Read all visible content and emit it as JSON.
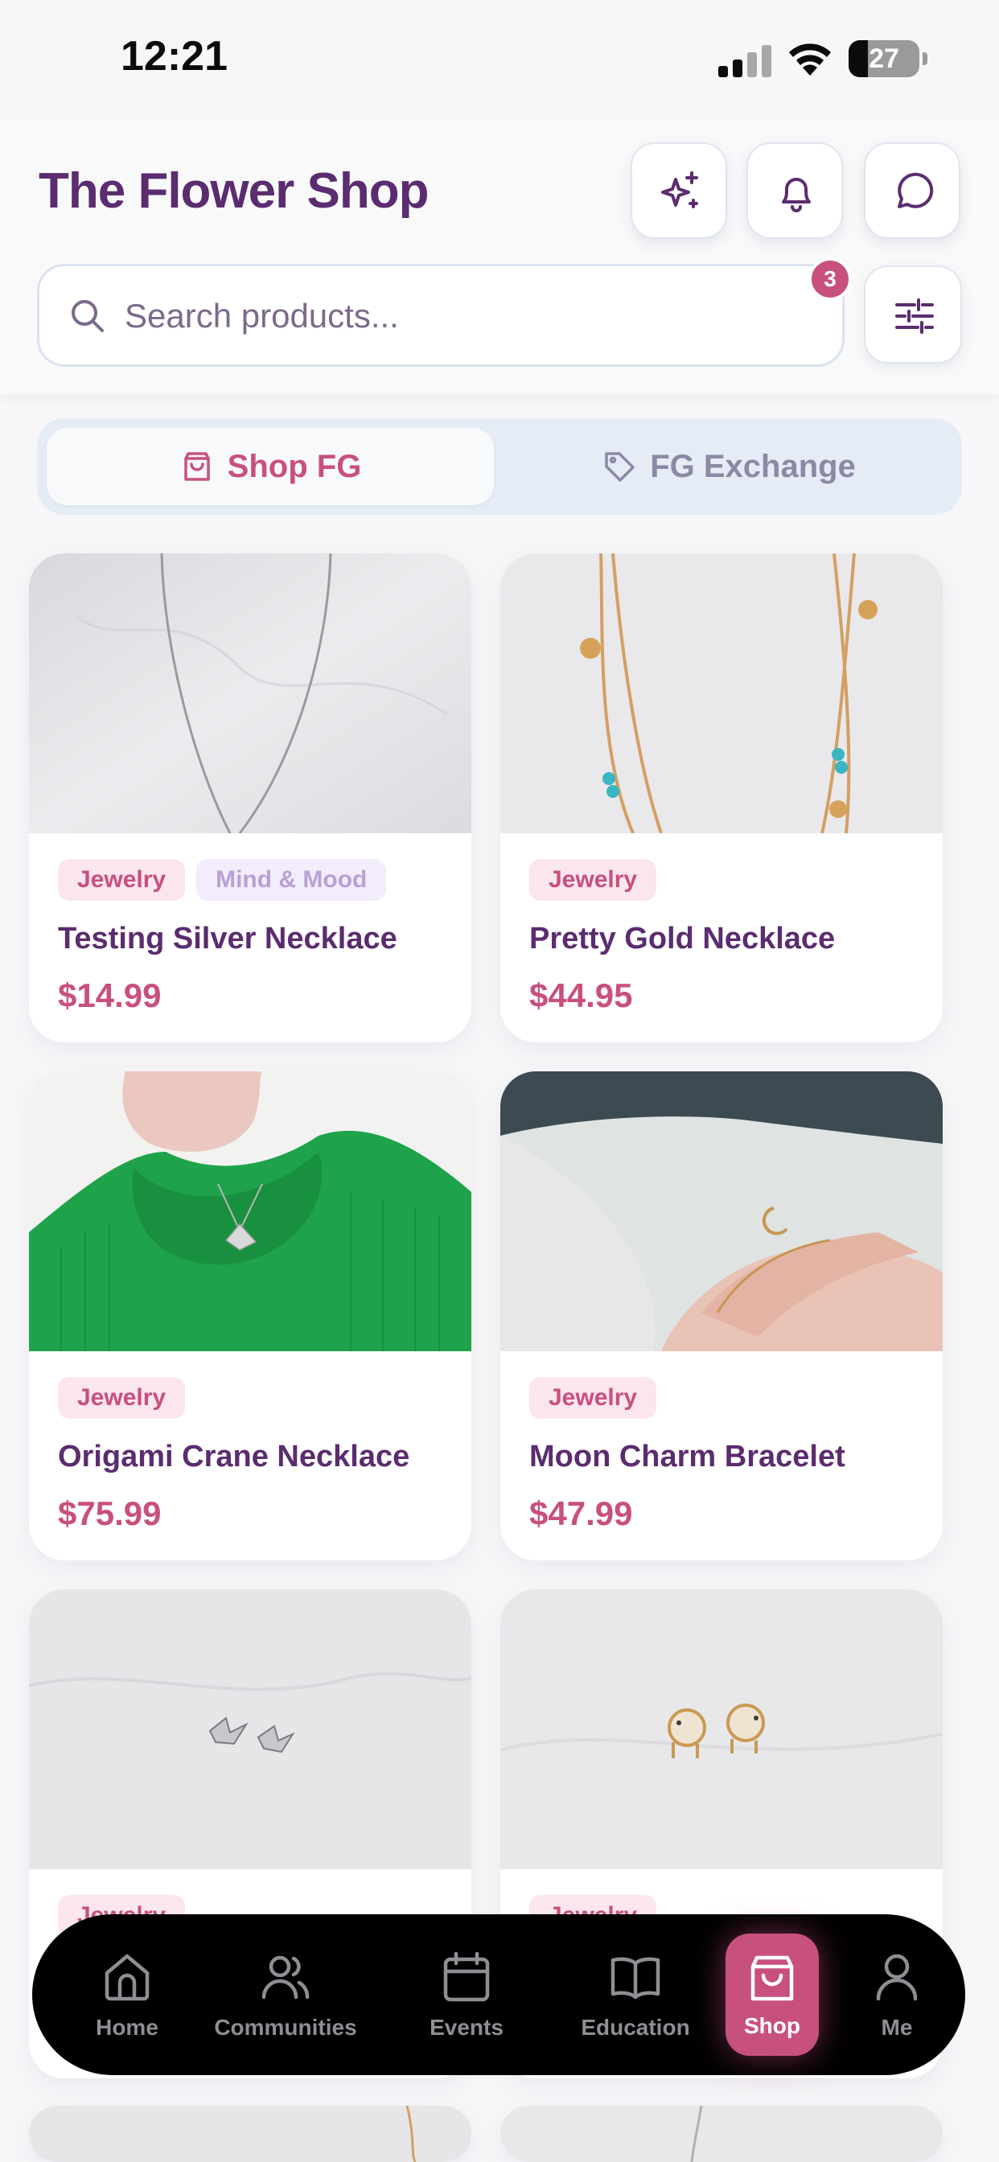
{
  "status_bar": {
    "time": "12:21",
    "battery_level": "27",
    "battery_fraction": 0.27
  },
  "header": {
    "title": "The Flower Shop",
    "notification_count": "3",
    "icons": [
      "sparkles-icon",
      "bell-icon",
      "chat-bubble-icon",
      "sliders-icon"
    ]
  },
  "search": {
    "placeholder": "Search products...",
    "value": ""
  },
  "tabs": [
    {
      "label": "Shop FG",
      "icon": "shopping-bag-icon",
      "active": true
    },
    {
      "label": "FG Exchange",
      "icon": "tag-icon",
      "active": false
    }
  ],
  "products": [
    {
      "tags": [
        "Jewelry",
        "Mind & Mood"
      ],
      "name": "Testing Silver Necklace",
      "price": "$14.99"
    },
    {
      "tags": [
        "Jewelry"
      ],
      "name": "Pretty Gold Necklace",
      "price": "$44.95"
    },
    {
      "tags": [
        "Jewelry"
      ],
      "name": "Origami Crane Necklace",
      "price": "$75.99"
    },
    {
      "tags": [
        "Jewelry"
      ],
      "name": "Moon Charm Bracelet",
      "price": "$47.99"
    },
    {
      "tags": [
        "Jewelry"
      ],
      "name": "",
      "price": ""
    },
    {
      "tags": [
        "Jewelry"
      ],
      "name": "",
      "price": ""
    }
  ],
  "nav": [
    {
      "label": "Home",
      "icon": "home-icon",
      "active": false
    },
    {
      "label": "Communities",
      "icon": "users-icon",
      "active": false
    },
    {
      "label": "Events",
      "icon": "calendar-icon",
      "active": false
    },
    {
      "label": "Education",
      "icon": "book-icon",
      "active": false
    },
    {
      "label": "Shop",
      "icon": "shopping-bag-icon",
      "active": true
    },
    {
      "label": "Me",
      "icon": "user-icon",
      "active": false
    }
  ],
  "colors": {
    "brand_purple": "#5b2c6f",
    "accent_pink": "#c8507e",
    "tag_bg": "#fbe6ee",
    "tag_secondary_text": "#b7a1d6",
    "nav_bg": "#000000"
  }
}
